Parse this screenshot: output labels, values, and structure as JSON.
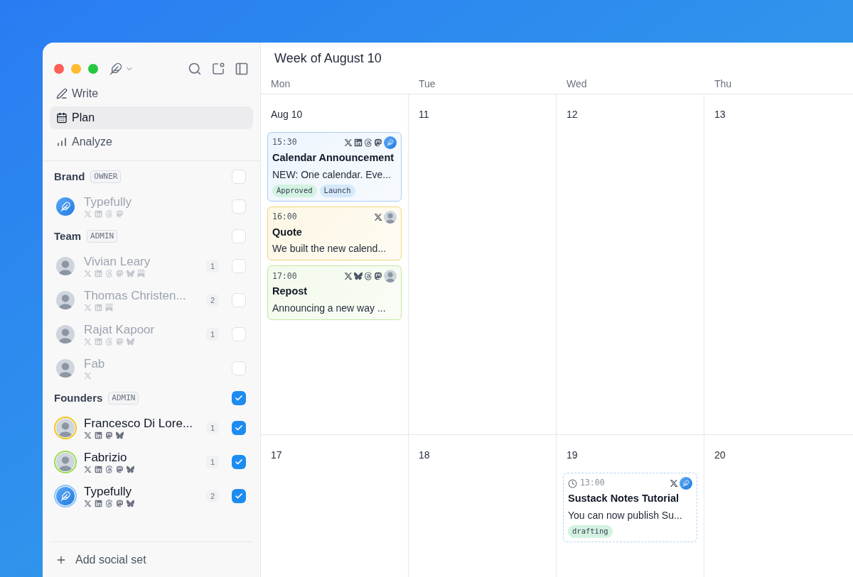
{
  "nav": [
    {
      "kind": "write",
      "label": "Write",
      "selected": false
    },
    {
      "kind": "plan",
      "label": "Plan",
      "selected": true
    },
    {
      "kind": "analyze",
      "label": "Analyze",
      "selected": false
    }
  ],
  "groups": [
    {
      "name": "Brand",
      "role": "OWNER",
      "checked": false,
      "accounts": [
        {
          "name": "Typefully",
          "avatar": {
            "kind": "logo"
          },
          "checked": false,
          "networks": [
            {
              "kind": "x"
            },
            {
              "kind": "linkedin"
            },
            {
              "kind": "threads"
            },
            {
              "kind": "mastodon"
            }
          ]
        }
      ]
    },
    {
      "name": "Team",
      "role": "ADMIN",
      "checked": false,
      "accounts": [
        {
          "name": "Vivian Leary",
          "avatar": {
            "kind": "person"
          },
          "count": "1",
          "checked": false,
          "networks": [
            {
              "kind": "x"
            },
            {
              "kind": "linkedin"
            },
            {
              "kind": "threads"
            },
            {
              "kind": "mastodon"
            },
            {
              "kind": "bluesky"
            },
            {
              "kind": "substack"
            }
          ]
        },
        {
          "name": "Thomas Christen...",
          "avatar": {
            "kind": "person"
          },
          "count": "2",
          "checked": false,
          "networks": [
            {
              "kind": "x"
            },
            {
              "kind": "linkedin"
            },
            {
              "kind": "substack"
            }
          ]
        },
        {
          "name": "Rajat Kapoor",
          "avatar": {
            "kind": "person"
          },
          "count": "1",
          "checked": false,
          "networks": [
            {
              "kind": "x"
            },
            {
              "kind": "linkedin"
            },
            {
              "kind": "threads"
            },
            {
              "kind": "mastodon"
            },
            {
              "kind": "bluesky"
            }
          ]
        },
        {
          "name": "Fab",
          "avatar": {
            "kind": "person"
          },
          "checked": false,
          "networks": [
            {
              "kind": "x"
            }
          ]
        }
      ]
    },
    {
      "name": "Founders",
      "role": "ADMIN",
      "checked": true,
      "accounts": [
        {
          "name": "Francesco Di Lore...",
          "avatar": {
            "kind": "person",
            "color": "#f5c518"
          },
          "count": "1",
          "checked": true,
          "networks": [
            {
              "kind": "x"
            },
            {
              "kind": "linkedin"
            },
            {
              "kind": "mastodon"
            },
            {
              "kind": "bluesky"
            }
          ]
        },
        {
          "name": "Fabrizio",
          "avatar": {
            "kind": "person",
            "color": "#9bdc4a"
          },
          "count": "1",
          "checked": true,
          "networks": [
            {
              "kind": "x"
            },
            {
              "kind": "linkedin"
            },
            {
              "kind": "threads"
            },
            {
              "kind": "mastodon"
            },
            {
              "kind": "bluesky"
            }
          ]
        },
        {
          "name": "Typefully",
          "avatar": {
            "kind": "logo",
            "color": "#8cc4f8"
          },
          "count": "2",
          "checked": true,
          "networks": [
            {
              "kind": "x"
            },
            {
              "kind": "linkedin"
            },
            {
              "kind": "threads"
            },
            {
              "kind": "mastodon"
            },
            {
              "kind": "bluesky"
            }
          ]
        }
      ]
    }
  ],
  "add_button": "Add social set",
  "title": "Week of August 10",
  "day_headers": [
    "Mon",
    "Tue",
    "Wed",
    "Thu"
  ],
  "weeks": [
    {
      "days": [
        {
          "label": "Aug 10",
          "posts": [
            {
              "kind": "scheduled",
              "time": "15:30",
              "title": "Calendar Announcement",
              "text": "NEW: One calendar. Eve...",
              "color": "#a8cdf5",
              "networks": [
                {
                  "kind": "x"
                },
                {
                  "kind": "linkedin"
                },
                {
                  "kind": "threads"
                },
                {
                  "kind": "mastodon"
                }
              ],
              "avatar": {
                "kind": "logo"
              },
              "tags": [
                {
                  "label": "Approved",
                  "color": "#d3f2e2"
                },
                {
                  "label": "Launch",
                  "color": "#d6e9fb"
                }
              ]
            },
            {
              "kind": "scheduled",
              "time": "16:00",
              "title": "Quote",
              "text": "We built the new calend...",
              "color": "#f4d57a",
              "networks": [
                {
                  "kind": "x"
                }
              ],
              "avatar": {
                "kind": "person"
              }
            },
            {
              "kind": "scheduled",
              "time": "17:00",
              "title": "Repost",
              "text": "Announcing a new way ...",
              "color": "#c2e69e",
              "networks": [
                {
                  "kind": "x"
                },
                {
                  "kind": "bluesky"
                },
                {
                  "kind": "threads"
                },
                {
                  "kind": "mastodon"
                }
              ],
              "avatar": {
                "kind": "person"
              }
            }
          ]
        },
        {
          "label": "11"
        },
        {
          "label": "12"
        },
        {
          "label": "13"
        }
      ]
    },
    {
      "days": [
        {
          "label": "17"
        },
        {
          "label": "18"
        },
        {
          "label": "19",
          "posts": [
            {
              "kind": "draft",
              "time": "13:00",
              "title": "Sustack Notes Tutorial",
              "text": "You can now publish Su...",
              "color": "#b5d3f0",
              "networks": [
                {
                  "kind": "x"
                }
              ],
              "avatar": {
                "kind": "logo"
              },
              "tags": [
                {
                  "label": "drafting",
                  "color": "#d3f2e2"
                }
              ]
            }
          ]
        },
        {
          "label": "20"
        }
      ]
    }
  ]
}
